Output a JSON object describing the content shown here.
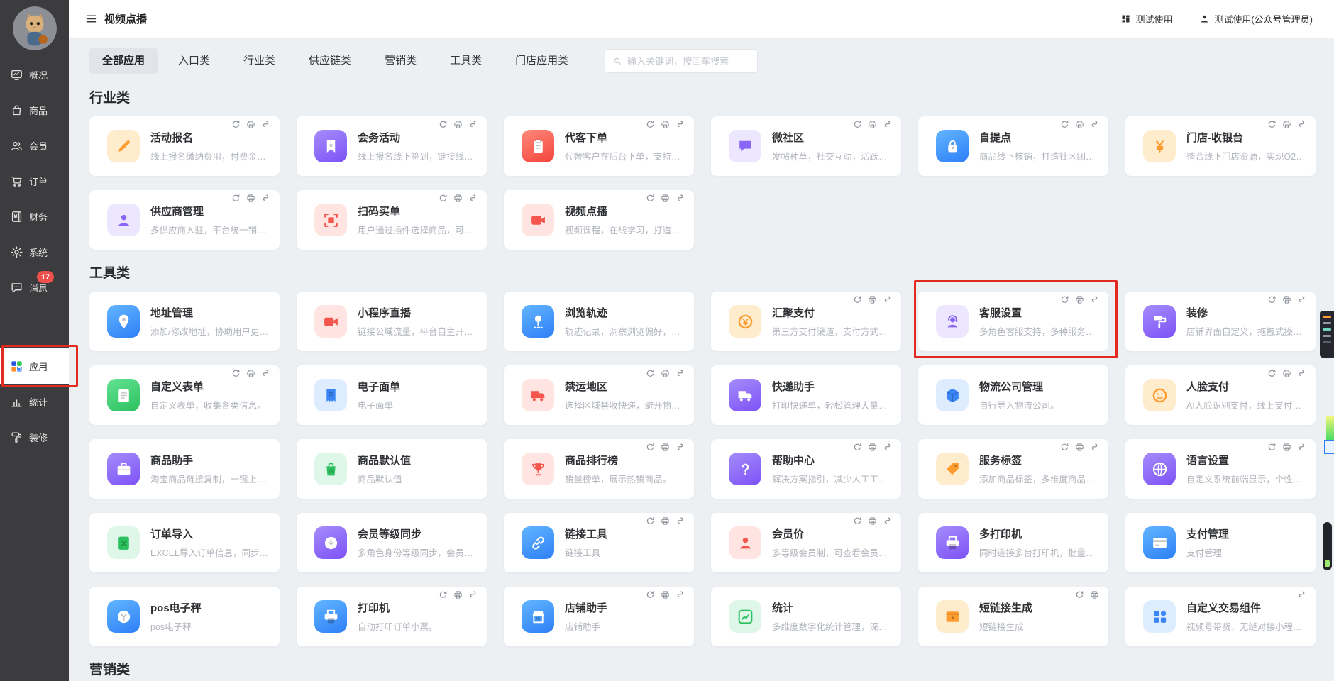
{
  "header": {
    "title": "视频点播",
    "workspace": "测试使用",
    "account": "测试使用(公众号管理员)"
  },
  "sidebar": {
    "items": [
      {
        "id": "overview",
        "label": "概况",
        "icon": "overview-icon"
      },
      {
        "id": "goods",
        "label": "商品",
        "icon": "goods-icon"
      },
      {
        "id": "member",
        "label": "会员",
        "icon": "member-icon"
      },
      {
        "id": "order",
        "label": "订单",
        "icon": "order-icon"
      },
      {
        "id": "finance",
        "label": "财务",
        "icon": "finance-icon"
      },
      {
        "id": "system",
        "label": "系统",
        "icon": "system-icon"
      },
      {
        "id": "message",
        "label": "消息",
        "icon": "message-icon",
        "badge": "17"
      },
      {
        "id": "apps",
        "label": "应用",
        "icon": "apps-icon",
        "active": true,
        "annotated": true,
        "spacer_before": true
      },
      {
        "id": "stats",
        "label": "统计",
        "icon": "stats-icon"
      },
      {
        "id": "deco",
        "label": "装修",
        "icon": "deco-icon"
      }
    ]
  },
  "tabs": {
    "items": [
      "全部应用",
      "入口类",
      "行业类",
      "供应链类",
      "营销类",
      "工具类",
      "门店应用类"
    ],
    "active_index": 0
  },
  "search": {
    "placeholder": "输入关键词，按回车搜索"
  },
  "annotation_color": "#e32a21",
  "sections": [
    {
      "title": "行业类",
      "apps": [
        {
          "name": "活动报名",
          "desc": "线上报名缴纳费用，付费金额营...",
          "icon": "pencil",
          "color": "orange",
          "variant": "soft",
          "actions": [
            "refresh",
            "printer",
            "link"
          ]
        },
        {
          "name": "会务活动",
          "desc": "线上报名线下签到，链接线下活...",
          "icon": "bookmark",
          "color": "purple",
          "variant": "solid",
          "actions": [
            "refresh",
            "printer",
            "link"
          ]
        },
        {
          "name": "代客下单",
          "desc": "代替客户在后台下单，支持自营...",
          "icon": "clipboard",
          "color": "red",
          "variant": "solid",
          "actions": [
            "refresh",
            "printer",
            "link"
          ]
        },
        {
          "name": "微社区",
          "desc": "发帖种草，社交互动，活跃带货。",
          "icon": "chat",
          "color": "purple",
          "variant": "soft",
          "actions": [
            "refresh",
            "printer",
            "link"
          ]
        },
        {
          "name": "自提点",
          "desc": "商品线下核销，打造社区团购平...",
          "icon": "lock",
          "color": "blue",
          "variant": "solid",
          "actions": [
            "refresh",
            "printer",
            "link"
          ]
        },
        {
          "name": "门店-收银台",
          "desc": "整合线下门店资源，实现O2O异...",
          "icon": "yen",
          "color": "orange",
          "variant": "soft",
          "actions": [
            "refresh",
            "printer",
            "link"
          ]
        },
        {
          "name": "供应商管理",
          "desc": "多供应商入驻，平台统一销售，...",
          "icon": "person",
          "color": "purple",
          "variant": "soft",
          "actions": [
            "refresh",
            "printer",
            "link"
          ]
        },
        {
          "name": "扫码买单",
          "desc": "用户通过插件选择商品，可以直...",
          "icon": "scan",
          "color": "red",
          "variant": "soft",
          "actions": [
            "refresh",
            "printer",
            "link"
          ]
        },
        {
          "name": "视频点播",
          "desc": "视频课程，在线学习，打造知识...",
          "icon": "video",
          "color": "red",
          "variant": "soft",
          "actions": [
            "refresh",
            "printer",
            "link"
          ]
        }
      ]
    },
    {
      "title": "工具类",
      "apps": [
        {
          "name": "地址管理",
          "desc": "添加/修改地址，协助用户更改信...",
          "icon": "pin",
          "color": "blue",
          "variant": "solid",
          "actions": []
        },
        {
          "name": "小程序直播",
          "desc": "链接公域流量，平台自主开播。",
          "icon": "camera",
          "color": "red",
          "variant": "soft",
          "actions": []
        },
        {
          "name": "浏览轨迹",
          "desc": "轨迹记录，洞察浏览偏好，进行...",
          "icon": "route",
          "color": "blue",
          "variant": "solid",
          "actions": []
        },
        {
          "name": "汇聚支付",
          "desc": "第三方支付渠道，支付方式多样...",
          "icon": "coin",
          "color": "orange",
          "variant": "soft",
          "actions": [
            "refresh",
            "printer",
            "link"
          ]
        },
        {
          "name": "客服设置",
          "desc": "多角色客服支持，多种服务入口。",
          "icon": "headset",
          "color": "purple",
          "variant": "soft",
          "actions": [
            "refresh",
            "printer",
            "link"
          ],
          "highlighted": true
        },
        {
          "name": "装修",
          "desc": "店铺界面自定义，拖拽式操作，...",
          "icon": "roller",
          "color": "purple",
          "variant": "solid",
          "actions": [
            "refresh",
            "printer",
            "link"
          ]
        },
        {
          "name": "自定义表单",
          "desc": "自定义表单，收集各类信息。",
          "icon": "form",
          "color": "green",
          "variant": "solid",
          "actions": [
            "refresh",
            "printer",
            "link"
          ]
        },
        {
          "name": "电子面单",
          "desc": "电子面单",
          "icon": "receipt",
          "color": "blue",
          "variant": "soft",
          "actions": []
        },
        {
          "name": "禁运地区",
          "desc": "选择区域禁收快递，避开物流收...",
          "icon": "truck",
          "color": "red",
          "variant": "soft",
          "actions": [
            "refresh",
            "printer",
            "link"
          ]
        },
        {
          "name": "快递助手",
          "desc": "打印快递单，轻松管理大量订单。",
          "icon": "truck",
          "color": "purple",
          "variant": "solid",
          "actions": []
        },
        {
          "name": "物流公司管理",
          "desc": "自行导入物流公司。",
          "icon": "box",
          "color": "blue",
          "variant": "soft",
          "actions": []
        },
        {
          "name": "人脸支付",
          "desc": "AI人脸识别支付，线上支付即成...",
          "icon": "face",
          "color": "orange",
          "variant": "soft",
          "actions": [
            "refresh",
            "printer",
            "link"
          ]
        },
        {
          "name": "商品助手",
          "desc": "淘宝商品链接复制，一键上传至...",
          "icon": "briefcase",
          "color": "purple",
          "variant": "solid",
          "actions": []
        },
        {
          "name": "商品默认值",
          "desc": "商品默认值",
          "icon": "bag",
          "color": "green",
          "variant": "soft",
          "actions": []
        },
        {
          "name": "商品排行榜",
          "desc": "销量榜单，展示热销商品。",
          "icon": "trophy",
          "color": "red",
          "variant": "soft",
          "actions": [
            "refresh",
            "printer",
            "link"
          ]
        },
        {
          "name": "帮助中心",
          "desc": "解决方案指引，减少人工工作量。",
          "icon": "question",
          "color": "purple",
          "variant": "solid",
          "actions": [
            "refresh",
            "printer",
            "link"
          ]
        },
        {
          "name": "服务标签",
          "desc": "添加商品标签，多维度商品标记。",
          "icon": "tag",
          "color": "orange",
          "variant": "soft",
          "actions": [
            "refresh",
            "printer",
            "link"
          ]
        },
        {
          "name": "语言设置",
          "desc": "自定义系统前端显示，个性化运...",
          "icon": "globe",
          "color": "purple",
          "variant": "solid",
          "actions": [
            "refresh",
            "printer",
            "link"
          ]
        },
        {
          "name": "订单导入",
          "desc": "EXCEL导入订单信息，同步管理。",
          "icon": "excel",
          "color": "green",
          "variant": "soft",
          "actions": []
        },
        {
          "name": "会员等级同步",
          "desc": "多角色身份等级同步，会员成长...",
          "icon": "sync",
          "color": "purple",
          "variant": "solid",
          "actions": []
        },
        {
          "name": "链接工具",
          "desc": "链接工具",
          "icon": "link",
          "color": "blue",
          "variant": "solid",
          "actions": [
            "refresh",
            "printer",
            "link"
          ]
        },
        {
          "name": "会员价",
          "desc": "多等级会员制，可查看会员价，...",
          "icon": "person",
          "color": "red",
          "variant": "soft",
          "actions": [
            "refresh",
            "printer",
            "link"
          ]
        },
        {
          "name": "多打印机",
          "desc": "同时连接多台打印机，批量完成...",
          "icon": "printer",
          "color": "purple",
          "variant": "solid",
          "actions": []
        },
        {
          "name": "支付管理",
          "desc": "支付管理",
          "icon": "card",
          "color": "blue",
          "variant": "solid",
          "actions": []
        },
        {
          "name": "pos电子秤",
          "desc": "pos电子秤",
          "icon": "scale",
          "color": "blue",
          "variant": "solid",
          "actions": []
        },
        {
          "name": "打印机",
          "desc": "自动打印订单小票。",
          "icon": "printer",
          "color": "blue",
          "variant": "solid",
          "actions": [
            "refresh",
            "printer",
            "link"
          ]
        },
        {
          "name": "店铺助手",
          "desc": "店铺助手",
          "icon": "store",
          "color": "blue",
          "variant": "solid",
          "actions": [
            "refresh",
            "printer",
            "link"
          ]
        },
        {
          "name": "统计",
          "desc": "多维度数字化统计管理，深度了...",
          "icon": "chart",
          "color": "green",
          "variant": "soft",
          "actions": []
        },
        {
          "name": "短链接生成",
          "desc": "短链接生成",
          "icon": "film",
          "color": "orange",
          "variant": "soft",
          "actions": [
            "refresh",
            "printer"
          ]
        },
        {
          "name": "自定义交易组件",
          "desc": "视频号带货，无缝对接小程序。",
          "icon": "grid",
          "color": "blue",
          "variant": "soft",
          "actions": [
            "link"
          ]
        }
      ]
    },
    {
      "title": "营销类",
      "apps": []
    }
  ]
}
